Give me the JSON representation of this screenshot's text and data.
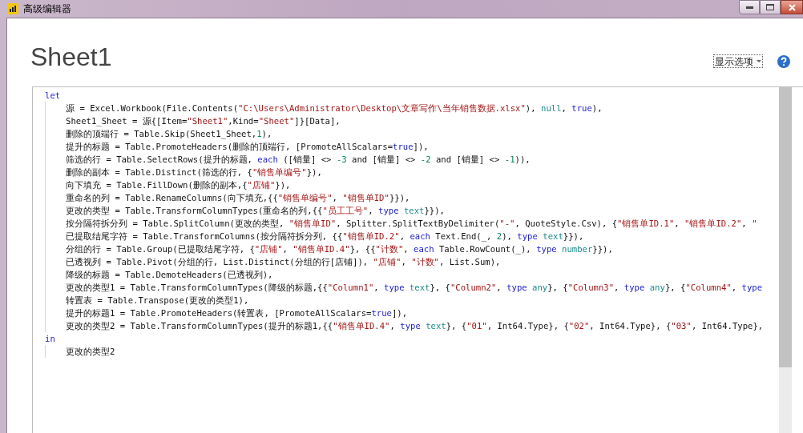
{
  "window": {
    "title": "高级编辑器"
  },
  "heading": "Sheet1",
  "options_button": {
    "label": "显示选项"
  },
  "editor": {
    "lines": [
      {
        "indented": false,
        "tokens": [
          {
            "kind": "keyword",
            "text": "let"
          }
        ]
      },
      {
        "indented": true,
        "tokens": [
          {
            "kind": "plain",
            "text": "源 = Excel.Workbook(File.Contents("
          },
          {
            "kind": "string",
            "text": "\"C:\\Users\\Administrator\\Desktop\\文章写作\\当年销售数据.xlsx\""
          },
          {
            "kind": "plain",
            "text": "), "
          },
          {
            "kind": "constant",
            "text": "null"
          },
          {
            "kind": "plain",
            "text": ", "
          },
          {
            "kind": "keyword",
            "text": "true"
          },
          {
            "kind": "plain",
            "text": "),"
          }
        ]
      },
      {
        "indented": true,
        "tokens": [
          {
            "kind": "plain",
            "text": "Sheet1_Sheet = 源{[Item="
          },
          {
            "kind": "string",
            "text": "\"Sheet1\""
          },
          {
            "kind": "plain",
            "text": ",Kind="
          },
          {
            "kind": "string",
            "text": "\"Sheet\""
          },
          {
            "kind": "plain",
            "text": "]}[Data],"
          }
        ]
      },
      {
        "indented": true,
        "tokens": [
          {
            "kind": "plain",
            "text": "删除的顶端行 = Table.Skip(Sheet1_Sheet,"
          },
          {
            "kind": "number",
            "text": "1"
          },
          {
            "kind": "plain",
            "text": "),"
          }
        ]
      },
      {
        "indented": true,
        "tokens": [
          {
            "kind": "plain",
            "text": "提升的标题 = Table.PromoteHeaders(删除的顶端行, [PromoteAllScalars="
          },
          {
            "kind": "keyword",
            "text": "true"
          },
          {
            "kind": "plain",
            "text": "]),"
          }
        ]
      },
      {
        "indented": true,
        "tokens": [
          {
            "kind": "plain",
            "text": "筛选的行 = Table.SelectRows(提升的标题, "
          },
          {
            "kind": "keyword",
            "text": "each"
          },
          {
            "kind": "plain",
            "text": " ([销量] <> "
          },
          {
            "kind": "number",
            "text": "-3"
          },
          {
            "kind": "plain",
            "text": " and [销量] <> "
          },
          {
            "kind": "number",
            "text": "-2"
          },
          {
            "kind": "plain",
            "text": " and [销量] <> "
          },
          {
            "kind": "number",
            "text": "-1"
          },
          {
            "kind": "plain",
            "text": ")),"
          }
        ]
      },
      {
        "indented": true,
        "tokens": [
          {
            "kind": "plain",
            "text": "删除的副本 = Table.Distinct(筛选的行, {"
          },
          {
            "kind": "string",
            "text": "\"销售单编号\""
          },
          {
            "kind": "plain",
            "text": "}),"
          }
        ]
      },
      {
        "indented": true,
        "tokens": [
          {
            "kind": "plain",
            "text": "向下填充 = Table.FillDown(删除的副本,{"
          },
          {
            "kind": "string",
            "text": "\"店铺\""
          },
          {
            "kind": "plain",
            "text": "}),"
          }
        ]
      },
      {
        "indented": true,
        "tokens": [
          {
            "kind": "plain",
            "text": "重命名的列 = Table.RenameColumns(向下填充,{{"
          },
          {
            "kind": "string",
            "text": "\"销售单编号\""
          },
          {
            "kind": "plain",
            "text": ", "
          },
          {
            "kind": "string",
            "text": "\"销售单ID\""
          },
          {
            "kind": "plain",
            "text": "}}),"
          }
        ]
      },
      {
        "indented": true,
        "tokens": [
          {
            "kind": "plain",
            "text": "更改的类型 = Table.TransformColumnTypes(重命名的列,{{"
          },
          {
            "kind": "string",
            "text": "\"员工工号\""
          },
          {
            "kind": "plain",
            "text": ", "
          },
          {
            "kind": "keyword",
            "text": "type"
          },
          {
            "kind": "constant",
            "text": " text"
          },
          {
            "kind": "plain",
            "text": "}}),"
          }
        ]
      },
      {
        "indented": true,
        "tokens": [
          {
            "kind": "plain",
            "text": "按分隔符拆分列 = Table.SplitColumn(更改的类型, "
          },
          {
            "kind": "string",
            "text": "\"销售单ID\""
          },
          {
            "kind": "plain",
            "text": ", Splitter.SplitTextByDelimiter("
          },
          {
            "kind": "string",
            "text": "\"-\""
          },
          {
            "kind": "plain",
            "text": ", QuoteStyle.Csv), {"
          },
          {
            "kind": "string",
            "text": "\"销售单ID.1\""
          },
          {
            "kind": "plain",
            "text": ", "
          },
          {
            "kind": "string",
            "text": "\"销售单ID.2\""
          },
          {
            "kind": "plain",
            "text": ", "
          },
          {
            "kind": "string",
            "text": "\""
          }
        ]
      },
      {
        "indented": true,
        "tokens": [
          {
            "kind": "plain",
            "text": "已提取结尾字符 = Table.TransformColumns(按分隔符拆分列, {{"
          },
          {
            "kind": "string",
            "text": "\"销售单ID.2\""
          },
          {
            "kind": "plain",
            "text": ", "
          },
          {
            "kind": "keyword",
            "text": "each"
          },
          {
            "kind": "plain",
            "text": " Text.End(_, "
          },
          {
            "kind": "number",
            "text": "2"
          },
          {
            "kind": "plain",
            "text": "), "
          },
          {
            "kind": "keyword",
            "text": "type"
          },
          {
            "kind": "constant",
            "text": " text"
          },
          {
            "kind": "plain",
            "text": "}}),"
          }
        ]
      },
      {
        "indented": true,
        "tokens": [
          {
            "kind": "plain",
            "text": "分组的行 = Table.Group(已提取结尾字符, {"
          },
          {
            "kind": "string",
            "text": "\"店铺\""
          },
          {
            "kind": "plain",
            "text": ", "
          },
          {
            "kind": "string",
            "text": "\"销售单ID.4\""
          },
          {
            "kind": "plain",
            "text": "}, {{"
          },
          {
            "kind": "string",
            "text": "\"计数\""
          },
          {
            "kind": "plain",
            "text": ", "
          },
          {
            "kind": "keyword",
            "text": "each"
          },
          {
            "kind": "plain",
            "text": " Table.RowCount(_), "
          },
          {
            "kind": "keyword",
            "text": "type"
          },
          {
            "kind": "constant",
            "text": " number"
          },
          {
            "kind": "plain",
            "text": "}}),"
          }
        ]
      },
      {
        "indented": true,
        "tokens": [
          {
            "kind": "plain",
            "text": "已透视列 = Table.Pivot(分组的行, List.Distinct(分组的行[店铺]), "
          },
          {
            "kind": "string",
            "text": "\"店铺\""
          },
          {
            "kind": "plain",
            "text": ", "
          },
          {
            "kind": "string",
            "text": "\"计数\""
          },
          {
            "kind": "plain",
            "text": ", List.Sum),"
          }
        ]
      },
      {
        "indented": true,
        "tokens": [
          {
            "kind": "plain",
            "text": "降级的标题 = Table.DemoteHeaders(已透视列),"
          }
        ]
      },
      {
        "indented": true,
        "tokens": [
          {
            "kind": "plain",
            "text": "更改的类型1 = Table.TransformColumnTypes(降级的标题,{{"
          },
          {
            "kind": "string",
            "text": "\"Column1\""
          },
          {
            "kind": "plain",
            "text": ", "
          },
          {
            "kind": "keyword",
            "text": "type"
          },
          {
            "kind": "constant",
            "text": " text"
          },
          {
            "kind": "plain",
            "text": "}, {"
          },
          {
            "kind": "string",
            "text": "\"Column2\""
          },
          {
            "kind": "plain",
            "text": ", "
          },
          {
            "kind": "keyword",
            "text": "type"
          },
          {
            "kind": "constant",
            "text": " any"
          },
          {
            "kind": "plain",
            "text": "}, {"
          },
          {
            "kind": "string",
            "text": "\"Column3\""
          },
          {
            "kind": "plain",
            "text": ", "
          },
          {
            "kind": "keyword",
            "text": "type"
          },
          {
            "kind": "constant",
            "text": " any"
          },
          {
            "kind": "plain",
            "text": "}, {"
          },
          {
            "kind": "string",
            "text": "\"Column4\""
          },
          {
            "kind": "plain",
            "text": ", "
          },
          {
            "kind": "keyword",
            "text": "type"
          }
        ]
      },
      {
        "indented": true,
        "tokens": [
          {
            "kind": "plain",
            "text": "转置表 = Table.Transpose(更改的类型1),"
          }
        ]
      },
      {
        "indented": true,
        "tokens": [
          {
            "kind": "plain",
            "text": "提升的标题1 = Table.PromoteHeaders(转置表, [PromoteAllScalars="
          },
          {
            "kind": "keyword",
            "text": "true"
          },
          {
            "kind": "plain",
            "text": "]),"
          }
        ]
      },
      {
        "indented": true,
        "tokens": [
          {
            "kind": "plain",
            "text": "更改的类型2 = Table.TransformColumnTypes(提升的标题1,{{"
          },
          {
            "kind": "string",
            "text": "\"销售单ID.4\""
          },
          {
            "kind": "plain",
            "text": ", "
          },
          {
            "kind": "keyword",
            "text": "type"
          },
          {
            "kind": "constant",
            "text": " text"
          },
          {
            "kind": "plain",
            "text": "}, {"
          },
          {
            "kind": "string",
            "text": "\"01\""
          },
          {
            "kind": "plain",
            "text": ", Int64.Type}, {"
          },
          {
            "kind": "string",
            "text": "\"02\""
          },
          {
            "kind": "plain",
            "text": ", Int64.Type}, {"
          },
          {
            "kind": "string",
            "text": "\"03\""
          },
          {
            "kind": "plain",
            "text": ", Int64.Type},"
          }
        ]
      },
      {
        "indented": false,
        "tokens": [
          {
            "kind": "keyword",
            "text": "in"
          }
        ]
      },
      {
        "indented": true,
        "tokens": [
          {
            "kind": "plain",
            "text": "更改的类型2"
          }
        ]
      }
    ]
  }
}
